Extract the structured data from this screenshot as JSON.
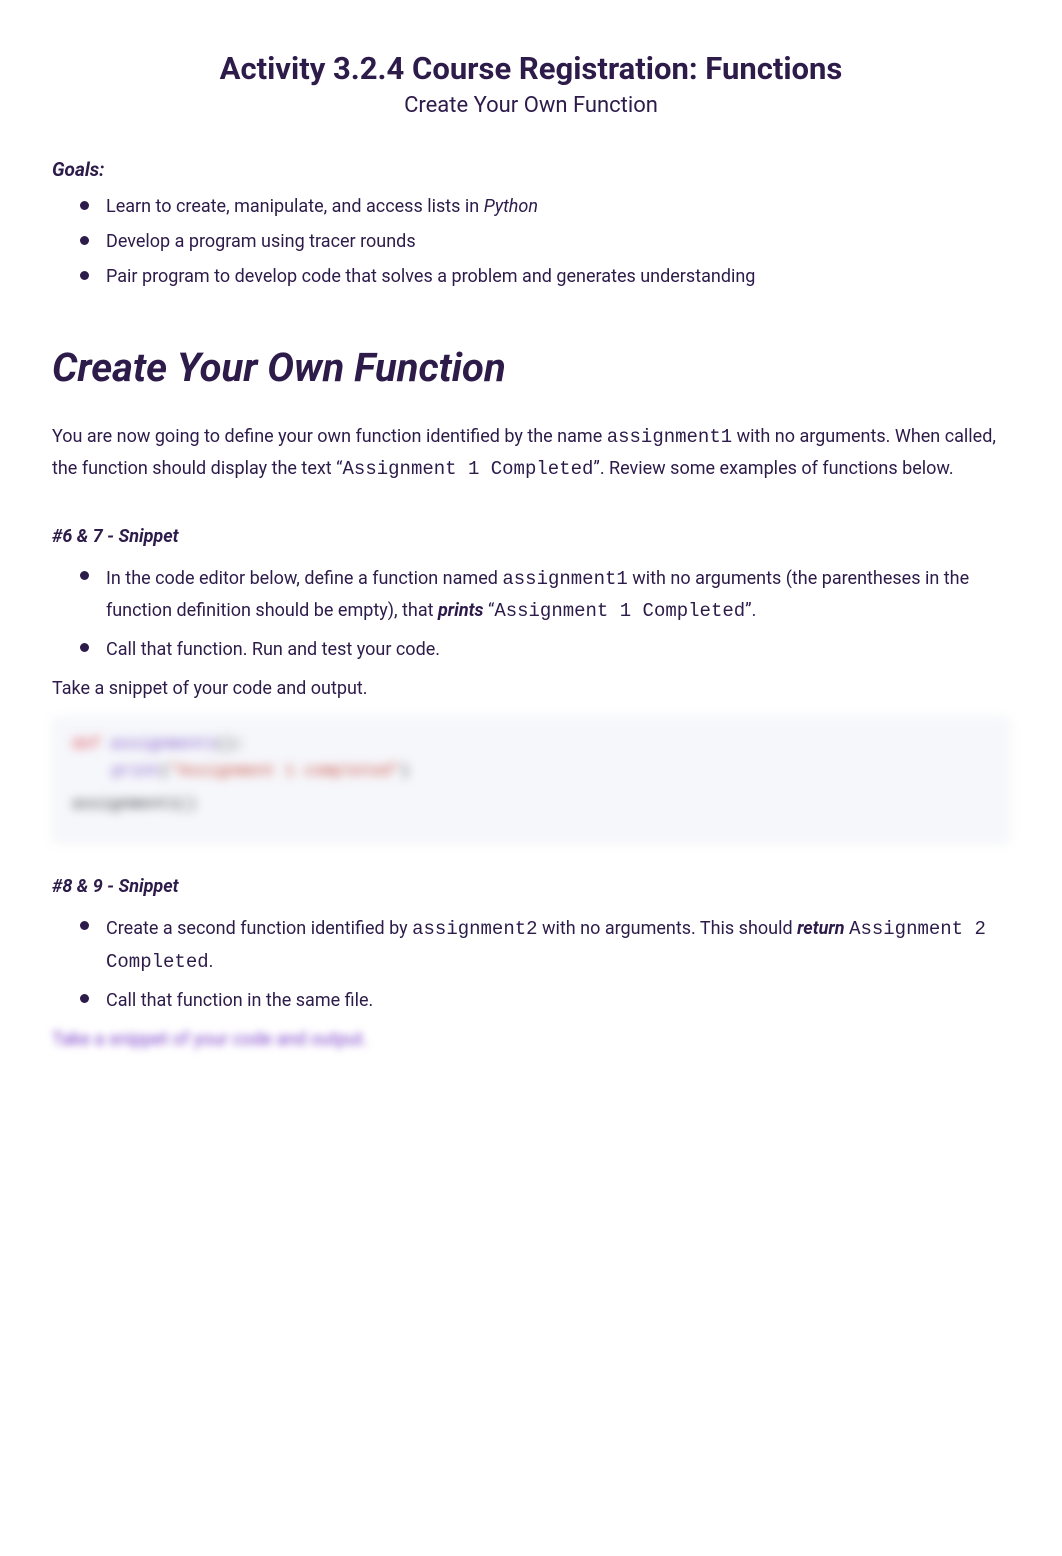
{
  "header": {
    "title": "Activity 3.2.4 Course Registration: Functions",
    "subtitle": "Create Your Own Function"
  },
  "goals_label": "Goals:",
  "goals": [
    {
      "prefix": "Learn to create, manipulate, and access lists in ",
      "italic": "Python"
    },
    {
      "text": "Develop a program using tracer rounds"
    },
    {
      "text": "Pair program to develop code that solves a problem and generates understanding"
    }
  ],
  "section_heading": "Create Your Own Function",
  "intro": {
    "p1a": "You are now going to define your own function identified by the name ",
    "code1": "assignment1",
    "p1b": " with no arguments. When called, the function should display the text ",
    "quote_open": "“",
    "code2": "Assignment 1 Completed",
    "quote_close": "”",
    "p1c": ". Review some examples of functions below."
  },
  "snippet67": {
    "label": "#6 & 7 - Snippet",
    "item1": {
      "a": "In the code editor below, define a function named ",
      "code1": "assignment1",
      "b": " with no arguments (the parentheses in the function definition should be empty), that ",
      "bold": "prints",
      "c": " “",
      "code2": "Assignment 1 Completed",
      "d": "”."
    },
    "item2": "Call that function. Run and test your code.",
    "take_snippet": "Take a snippet of your code and output."
  },
  "code_block": {
    "line1_kw": "def",
    "line1_fn": "assignment1",
    "line1_rest": "():",
    "line2_fn": "print",
    "line2_str": "\"Assignment 1 completed\"",
    "line3": "assignment1()"
  },
  "snippet89": {
    "label": "#8 & 9 - Snippet",
    "item1": {
      "a": "Create a second function identified by ",
      "code1": "assignment2",
      "b": " with no arguments. This should ",
      "bold": "return",
      "c": " ",
      "code2": "Assignment 2 Completed",
      "d": "."
    },
    "item2": "Call that function in the same file.",
    "take_snippet": "Take a snippet of your code and output."
  }
}
